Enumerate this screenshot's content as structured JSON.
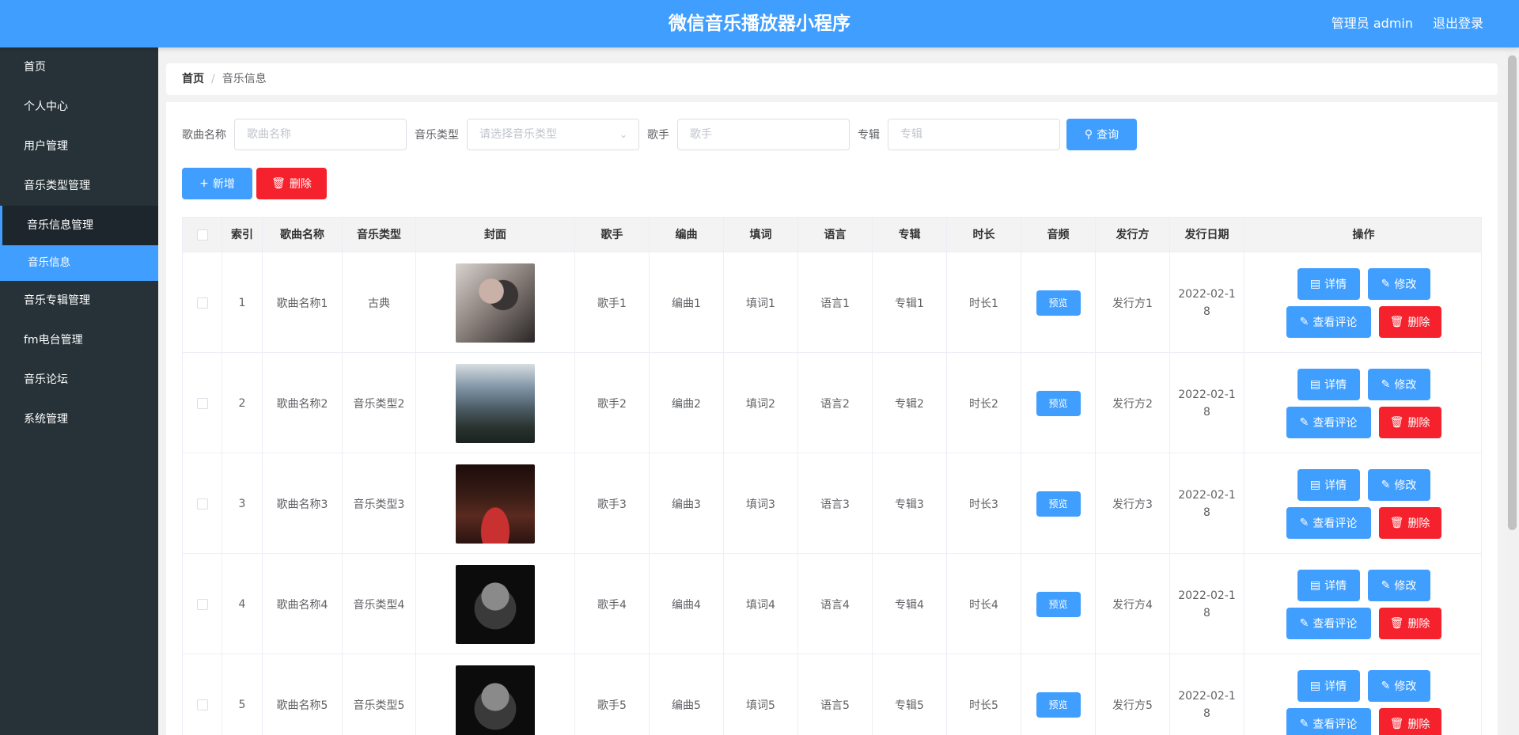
{
  "header": {
    "title": "微信音乐播放器小程序",
    "user": "管理员 admin",
    "logout": "退出登录"
  },
  "sidebar": {
    "items": [
      {
        "label": "首页"
      },
      {
        "label": "个人中心"
      },
      {
        "label": "用户管理"
      },
      {
        "label": "音乐类型管理"
      },
      {
        "label": "音乐信息管理"
      },
      {
        "label": "音乐信息"
      },
      {
        "label": "音乐专辑管理"
      },
      {
        "label": "fm电台管理"
      },
      {
        "label": "音乐论坛"
      },
      {
        "label": "系统管理"
      }
    ]
  },
  "breadcrumb": {
    "home": "首页",
    "sep": "/",
    "current": "音乐信息"
  },
  "search": {
    "song_label": "歌曲名称",
    "song_placeholder": "歌曲名称",
    "type_label": "音乐类型",
    "type_placeholder": "请选择音乐类型",
    "singer_label": "歌手",
    "singer_placeholder": "歌手",
    "album_label": "专辑",
    "album_placeholder": "专辑",
    "query_btn": "查询"
  },
  "actions": {
    "add": "新增",
    "delete": "删除"
  },
  "table": {
    "headers": [
      "索引",
      "歌曲名称",
      "音乐类型",
      "封面",
      "歌手",
      "编曲",
      "填词",
      "语言",
      "专辑",
      "时长",
      "音频",
      "发行方",
      "发行日期",
      "操作"
    ],
    "rows": [
      {
        "index": "1",
        "name": "歌曲名称1",
        "type": "古典",
        "singer": "歌手1",
        "arranger": "编曲1",
        "lyricist": "填词1",
        "language": "语言1",
        "album": "专辑1",
        "duration": "时长1",
        "publisher": "发行方1",
        "date": "2022-02-18"
      },
      {
        "index": "2",
        "name": "歌曲名称2",
        "type": "音乐类型2",
        "singer": "歌手2",
        "arranger": "编曲2",
        "lyricist": "填词2",
        "language": "语言2",
        "album": "专辑2",
        "duration": "时长2",
        "publisher": "发行方2",
        "date": "2022-02-18"
      },
      {
        "index": "3",
        "name": "歌曲名称3",
        "type": "音乐类型3",
        "singer": "歌手3",
        "arranger": "编曲3",
        "lyricist": "填词3",
        "language": "语言3",
        "album": "专辑3",
        "duration": "时长3",
        "publisher": "发行方3",
        "date": "2022-02-18"
      },
      {
        "index": "4",
        "name": "歌曲名称4",
        "type": "音乐类型4",
        "singer": "歌手4",
        "arranger": "编曲4",
        "lyricist": "填词4",
        "language": "语言4",
        "album": "专辑4",
        "duration": "时长4",
        "publisher": "发行方4",
        "date": "2022-02-18"
      },
      {
        "index": "5",
        "name": "歌曲名称5",
        "type": "音乐类型5",
        "singer": "歌手5",
        "arranger": "编曲5",
        "lyricist": "填词5",
        "language": "语言5",
        "album": "专辑5",
        "duration": "时长5",
        "publisher": "发行方5",
        "date": "2022-02-18"
      }
    ],
    "preview_btn": "预览",
    "op_detail": "详情",
    "op_edit": "修改",
    "op_comments": "查看评论",
    "op_delete": "删除"
  },
  "colors": {
    "primary": "#409eff",
    "danger": "#f5222d",
    "sidebar": "#263238"
  }
}
